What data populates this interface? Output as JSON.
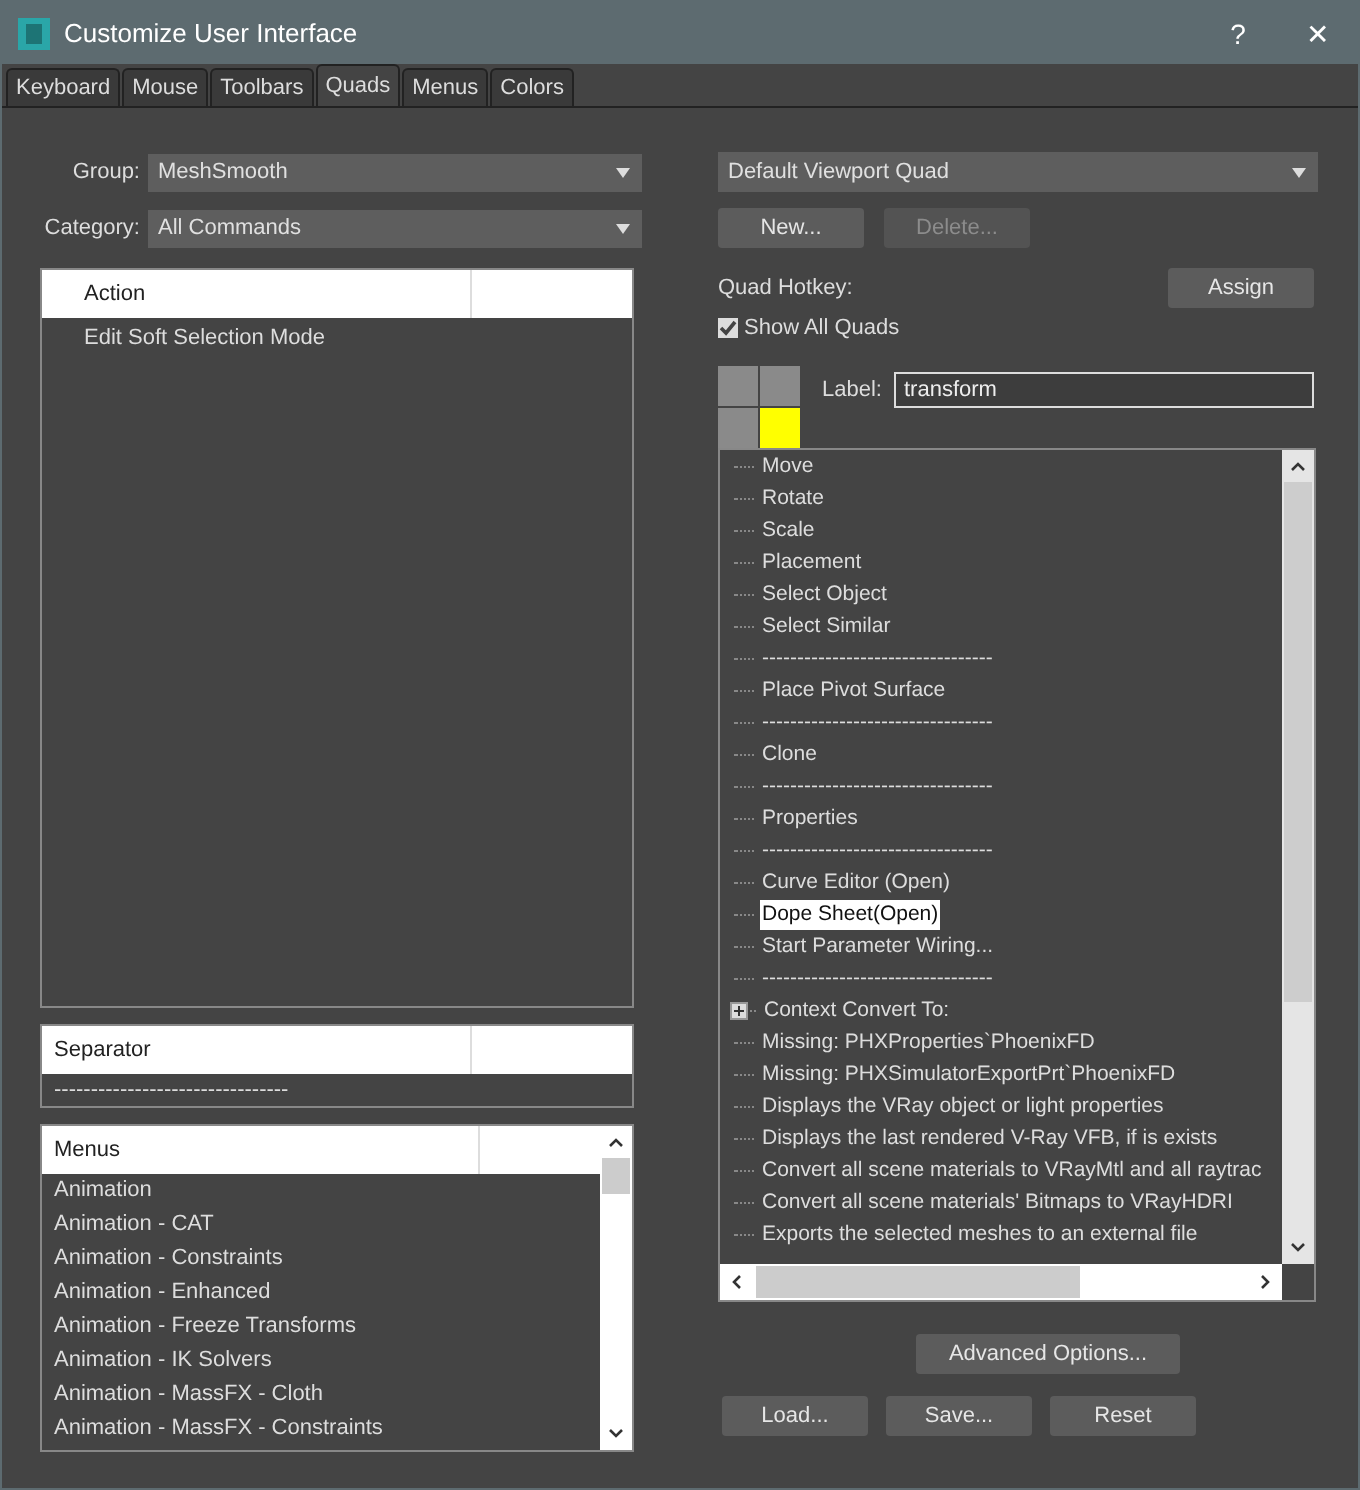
{
  "window": {
    "title": "Customize User Interface",
    "buttons": [
      "?",
      "✕"
    ]
  },
  "tabs": [
    {
      "label": "Keyboard",
      "selected": false
    },
    {
      "label": "Mouse",
      "selected": false
    },
    {
      "label": "Toolbars",
      "selected": false
    },
    {
      "label": "Quads",
      "selected": true
    },
    {
      "label": "Menus",
      "selected": false
    },
    {
      "label": "Colors",
      "selected": false
    }
  ],
  "group": {
    "label": "Group:",
    "value": "MeshSmooth"
  },
  "category": {
    "label": "Category:",
    "value": "All Commands"
  },
  "action_list": {
    "header": "Action",
    "rows": [
      "Edit Soft Selection Mode"
    ]
  },
  "separator_list": {
    "header": "Separator",
    "rows": [
      "--------------------------------"
    ]
  },
  "menus_list": {
    "header": "Menus",
    "rows": [
      "Animation",
      "Animation - CAT",
      "Animation - Constraints",
      "Animation - Enhanced",
      "Animation - Freeze Transforms",
      "Animation - IK Solvers",
      "Animation - MassFX - Cloth",
      "Animation - MassFX - Constraints"
    ]
  },
  "quad_set": {
    "value": "Default Viewport Quad"
  },
  "new_button": {
    "label": "New...",
    "disabled": false
  },
  "delete_button": {
    "label": "Delete...",
    "disabled": true
  },
  "quad_hotkey": {
    "label": "Quad Hotkey:"
  },
  "assign_button": {
    "label": "Assign"
  },
  "show_all_quads": {
    "label": "Show All Quads",
    "checked": true
  },
  "quads": [
    {
      "selected": false
    },
    {
      "selected": false
    },
    {
      "selected": false
    },
    {
      "selected": true
    }
  ],
  "quad_label": {
    "label": "Label:",
    "value": "transform"
  },
  "tree": [
    {
      "kind": "item",
      "text": "Move",
      "selected": false
    },
    {
      "kind": "item",
      "text": "Rotate",
      "selected": false
    },
    {
      "kind": "item",
      "text": "Scale",
      "selected": false
    },
    {
      "kind": "item",
      "text": "Placement",
      "selected": false
    },
    {
      "kind": "item",
      "text": "Select Object",
      "selected": false
    },
    {
      "kind": "item",
      "text": "Select Similar",
      "selected": false
    },
    {
      "kind": "item",
      "text": "---------------------------------",
      "selected": false
    },
    {
      "kind": "item",
      "text": "Place Pivot Surface",
      "selected": false
    },
    {
      "kind": "item",
      "text": "---------------------------------",
      "selected": false
    },
    {
      "kind": "item",
      "text": "Clone",
      "selected": false
    },
    {
      "kind": "item",
      "text": "---------------------------------",
      "selected": false
    },
    {
      "kind": "item",
      "text": "Properties",
      "selected": false
    },
    {
      "kind": "item",
      "text": "---------------------------------",
      "selected": false
    },
    {
      "kind": "item",
      "text": "Curve Editor (Open)",
      "selected": false
    },
    {
      "kind": "item",
      "text": "Dope Sheet(Open)",
      "selected": true
    },
    {
      "kind": "item",
      "text": "Start Parameter Wiring...",
      "selected": false
    },
    {
      "kind": "item",
      "text": "---------------------------------",
      "selected": false
    },
    {
      "kind": "group",
      "text": "Context Convert To:",
      "selected": false
    },
    {
      "kind": "item",
      "text": "Missing: PHXProperties`PhoenixFD",
      "selected": false
    },
    {
      "kind": "item",
      "text": "Missing: PHXSimulatorExportPrt`PhoenixFD",
      "selected": false
    },
    {
      "kind": "item",
      "text": "Displays the VRay object or light properties",
      "selected": false
    },
    {
      "kind": "item",
      "text": "Displays the last rendered V-Ray VFB, if is exists",
      "selected": false
    },
    {
      "kind": "item",
      "text": "Convert all scene materials to VRayMtl and all raytrac",
      "selected": false
    },
    {
      "kind": "item",
      "text": "Convert all scene materials' Bitmaps to VRayHDRI",
      "selected": false
    },
    {
      "kind": "item",
      "text": "Exports the selected meshes to an external file",
      "selected": false
    }
  ],
  "advanced_button": {
    "label": "Advanced Options..."
  },
  "bottom_buttons": [
    "Load...",
    "Save...",
    "Reset"
  ]
}
